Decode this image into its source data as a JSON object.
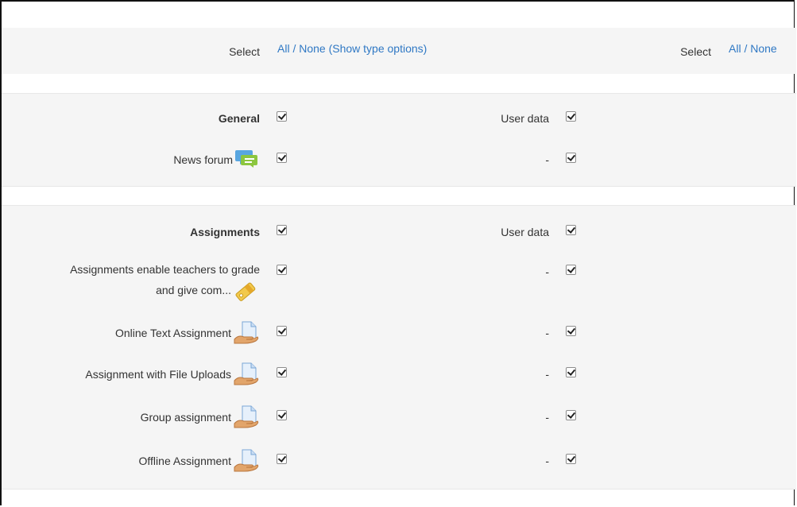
{
  "select_header": {
    "left_label": "Select",
    "all": "All",
    "sep": " / ",
    "none": "None",
    "type_options": "(Show type options)",
    "right_label": "Select",
    "right_all": "All",
    "right_none": "None"
  },
  "general": {
    "title": "General",
    "userdata_label": "User data",
    "items": [
      {
        "label": "News forum",
        "icon": "forum-icon",
        "userdata": "-"
      }
    ]
  },
  "assignments": {
    "title": "Assignments",
    "userdata_label": "User data",
    "items": [
      {
        "label_line1": "Assignments enable teachers to grade",
        "label_line2": "and give com...",
        "icon": "assignment-icon",
        "userdata": "-"
      },
      {
        "label": "Online Text Assignment",
        "icon": "document-hand-icon",
        "userdata": "-"
      },
      {
        "label": "Assignment with File Uploads",
        "icon": "document-hand-icon",
        "userdata": "-"
      },
      {
        "label": "Group assignment",
        "icon": "document-hand-icon",
        "userdata": "-"
      },
      {
        "label": "Offline Assignment",
        "icon": "document-hand-icon",
        "userdata": "-"
      }
    ]
  },
  "colors": {
    "link": "#2f78c4",
    "band": "#f5f5f5"
  }
}
